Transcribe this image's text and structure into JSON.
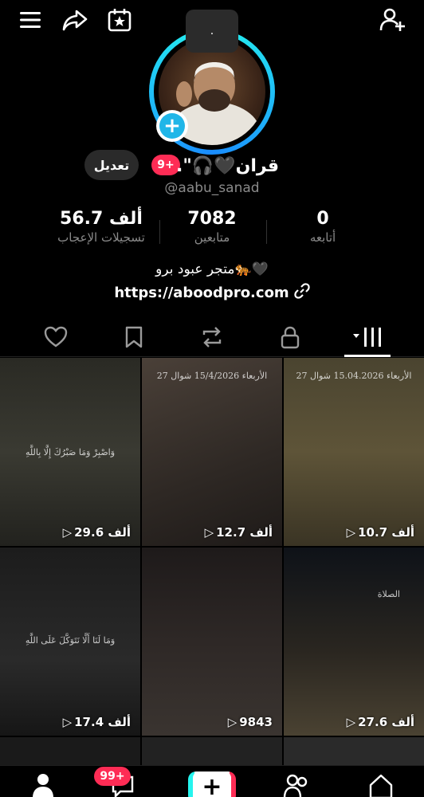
{
  "header": {
    "menu_icon": "hamburger-menu-icon",
    "share_icon": "share-arrow-icon",
    "calendar_icon": "calendar-star-icon",
    "add_user_icon": "add-user-icon",
    "tooltip_text": "."
  },
  "profile": {
    "name": "قران🖤🎧\".",
    "username": "@aabu_sanad",
    "edit_label": "تعديل",
    "notification_badge": "9+",
    "bio": "متجر عبود برو🐅🖤",
    "link": "https://aboodpro.com"
  },
  "stats": {
    "likes": {
      "value": "56.7 ألف",
      "label": "تسجيلات الإعجاب"
    },
    "followers": {
      "value": "7082",
      "label": "متابعين"
    },
    "following": {
      "value": "0",
      "label": "أتابعه"
    }
  },
  "tabs": [
    "liked-icon",
    "bookmark-icon",
    "repost-icon",
    "lock-icon",
    "videos-grid-icon"
  ],
  "videos": [
    {
      "count": "29.6 ألف",
      "caption": "وَاصْبِرْ وَمَا صَبْرُكَ إِلَّا بِاللَّهِ"
    },
    {
      "count": "12.7 ألف",
      "caption": "الأربعاء 15/4/2026 شوال 27"
    },
    {
      "count": "10.7 ألف",
      "caption": "الأربعاء 15.04.2026 شوال 27"
    },
    {
      "count": "17.4 ألف",
      "caption": "وَمَا لَنَا أَلَّا نَتَوَكَّلَ عَلَى اللَّهِ"
    },
    {
      "count": "9843",
      "caption": ""
    },
    {
      "count": "27.6 ألف",
      "caption": "الصلاة"
    }
  ],
  "bottom_nav": {
    "messages_badge": "99+",
    "create_label": "+"
  },
  "colors": {
    "accent_red": "#fe2c55",
    "accent_cyan": "#25f4ee",
    "muted_text": "#8a8a8a"
  }
}
